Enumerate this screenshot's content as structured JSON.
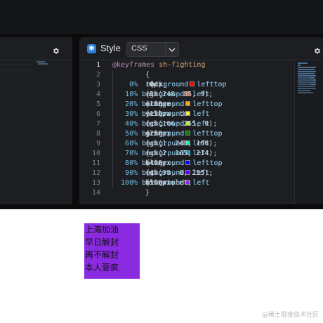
{
  "editor": {
    "panel_title": "Style",
    "language": "CSS",
    "gear_icon": "gear-icon",
    "lines": [
      {
        "n": "1",
        "parts": [
          [
            "kw",
            "@keyframes "
          ],
          [
            "sel",
            "sh-fighting"
          ]
        ]
      },
      {
        "n": "2",
        "parts": [
          [
            "txt",
            "{"
          ]
        ]
      },
      {
        "n": "3",
        "parts": [
          [
            "pct",
            "    0%  "
          ],
          [
            "txt",
            " {"
          ],
          [
            "prop",
            "background"
          ],
          [
            "txt",
            ": "
          ],
          [
            "sw",
            "#ff0000"
          ],
          [
            "txt",
            "red; "
          ],
          [
            "prop",
            "left"
          ],
          [
            "txt",
            ":0px; "
          ],
          [
            "prop",
            "top"
          ],
          [
            "txt",
            ":0px"
          ]
        ]
      },
      {
        "n": "4",
        "parts": [
          [
            "pct",
            "   10% "
          ],
          [
            "txt",
            "{"
          ],
          [
            "prop",
            "background"
          ],
          [
            "txt",
            ": "
          ],
          [
            "sw",
            "#f85509"
          ],
          [
            "txt",
            "rgb(248, 85, 9); "
          ],
          [
            "prop",
            "left"
          ],
          [
            "txt",
            ":5"
          ]
        ]
      },
      {
        "n": "5",
        "parts": [
          [
            "pct",
            "   20% "
          ],
          [
            "txt",
            "{"
          ],
          [
            "prop",
            "background"
          ],
          [
            "txt",
            ": "
          ],
          [
            "sw",
            "#ffa500"
          ],
          [
            "txt",
            "orange;"
          ],
          [
            "prop",
            "left"
          ],
          [
            "txt",
            ":100px; "
          ],
          [
            "prop",
            "top"
          ],
          [
            "txt",
            ":"
          ]
        ]
      },
      {
        "n": "6",
        "parts": [
          [
            "pct",
            "   30% "
          ],
          [
            "txt",
            "{"
          ],
          [
            "prop",
            "background"
          ],
          [
            "txt",
            ": "
          ],
          [
            "sw",
            "#ffff00"
          ],
          [
            "txt",
            "yellow; "
          ],
          [
            "prop",
            "left"
          ],
          [
            "txt",
            ":150px; to"
          ]
        ]
      },
      {
        "n": "7",
        "parts": [
          [
            "pct",
            "   40% "
          ],
          [
            "txt",
            "{"
          ],
          [
            "prop",
            "background"
          ],
          [
            "txt",
            ": "
          ],
          [
            "sw",
            "#a6ff00"
          ],
          [
            "txt",
            "rgb(166, 255, 0); "
          ],
          [
            "prop",
            "left"
          ],
          [
            "txt",
            ":"
          ]
        ]
      },
      {
        "n": "8",
        "parts": [
          [
            "pct",
            "   50% "
          ],
          [
            "txt",
            "{"
          ],
          [
            "prop",
            "background"
          ],
          [
            "txt",
            ": "
          ],
          [
            "sw",
            "#008000"
          ],
          [
            "txt",
            "green; "
          ],
          [
            "prop",
            "left"
          ],
          [
            "txt",
            ":250px; "
          ],
          [
            "prop",
            "top"
          ]
        ]
      },
      {
        "n": "9",
        "parts": [
          [
            "pct",
            "   60% "
          ],
          [
            "txt",
            "{"
          ],
          [
            "prop",
            "background"
          ],
          [
            "txt",
            ": "
          ],
          [
            "sw",
            "#01f8a6"
          ],
          [
            "txt",
            "rgb(1, 248, 166); "
          ],
          [
            "prop",
            "left"
          ]
        ]
      },
      {
        "n": "10",
        "parts": [
          [
            "pct",
            "   70% "
          ],
          [
            "txt",
            "{"
          ],
          [
            "prop",
            "background"
          ],
          [
            "txt",
            ": "
          ],
          [
            "sw",
            "#02a5d6"
          ],
          [
            "txt",
            "rgb(2, 165, 214); "
          ],
          [
            "prop",
            "left"
          ]
        ]
      },
      {
        "n": "11",
        "parts": [
          [
            "pct",
            "   80% "
          ],
          [
            "txt",
            "{"
          ],
          [
            "prop",
            "background"
          ],
          [
            "txt",
            ": "
          ],
          [
            "sw",
            "#0000ff"
          ],
          [
            "txt",
            "blue; "
          ],
          [
            "prop",
            "left"
          ],
          [
            "txt",
            ":400px; "
          ],
          [
            "prop",
            "top"
          ],
          [
            "txt",
            ":"
          ]
        ]
      },
      {
        "n": "12",
        "parts": [
          [
            "pct",
            "   90% "
          ],
          [
            "txt",
            "{"
          ],
          [
            "prop",
            "background"
          ],
          [
            "txt",
            ": "
          ],
          [
            "sw",
            "#6200ff"
          ],
          [
            "txt",
            "rgb(98, 0, 255); "
          ],
          [
            "prop",
            "left"
          ],
          [
            "txt",
            ":4"
          ]
        ]
      },
      {
        "n": "13",
        "parts": [
          [
            "pct",
            "  100% "
          ],
          [
            "txt",
            "{"
          ],
          [
            "prop",
            "background"
          ],
          [
            "txt",
            ": "
          ],
          [
            "sw",
            "#8a2be2"
          ],
          [
            "txt",
            "blueviolet; "
          ],
          [
            "prop",
            "left"
          ],
          [
            "txt",
            ":500px;"
          ]
        ]
      },
      {
        "n": "14",
        "parts": [
          [
            "txt",
            "}"
          ]
        ]
      }
    ]
  },
  "preview": {
    "background": "#8a2be2",
    "lines": [
      "上海加油",
      "早日解封",
      "再不解封",
      "本人要疯"
    ]
  },
  "watermark": "@稀土掘金技术社区"
}
